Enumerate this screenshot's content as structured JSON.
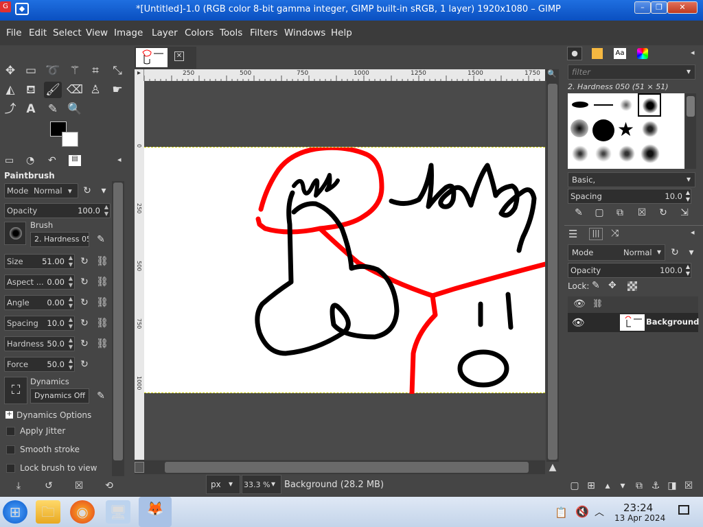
{
  "window": {
    "title": "*[Untitled]-1.0 (RGB color 8-bit gamma integer, GIMP built-in sRGB, 1 layer) 1920x1080 – GIMP",
    "minimize": "–",
    "maximize": "❐",
    "close": "✕"
  },
  "menu": [
    "File",
    "Edit",
    "Select",
    "View",
    "Image",
    "Layer",
    "Colors",
    "Tools",
    "Filters",
    "Windows",
    "Help"
  ],
  "tool_options": {
    "title": "Paintbrush",
    "mode_label": "Mode",
    "mode_value": "Normal",
    "opacity_label": "Opacity",
    "opacity_value": "100.0",
    "brush_label": "Brush",
    "brush_value": "2. Hardness 05",
    "size_label": "Size",
    "size_value": "51.00",
    "aspect_label": "Aspect ...",
    "aspect_value": "0.00",
    "angle_label": "Angle",
    "angle_value": "0.00",
    "spacing_label": "Spacing",
    "spacing_value": "10.0",
    "hardness_label": "Hardness",
    "hardness_value": "50.0",
    "force_label": "Force",
    "force_value": "50.0",
    "dynamics_label": "Dynamics",
    "dynamics_value": "Dynamics Off",
    "dynamics_options": "Dynamics Options",
    "apply_jitter": "Apply Jitter",
    "smooth_stroke": "Smooth stroke",
    "lock_brush": "Lock brush to view"
  },
  "ruler": {
    "top_ticks": [
      "250",
      "500",
      "750",
      "1000",
      "1250",
      "1500",
      "1750"
    ],
    "left_ticks": [
      "0",
      "250",
      "500",
      "750",
      "1000"
    ]
  },
  "status": {
    "unit": "px",
    "zoom": "33.3 %",
    "layer_info": "Background (28.2 MB)"
  },
  "brushes_panel": {
    "filter_placeholder": "filter",
    "brush_name": "2. Hardness 050 (51 × 51)",
    "tag": "Basic,",
    "spacing_label": "Spacing",
    "spacing_value": "10.0"
  },
  "layers_panel": {
    "mode_label": "Mode",
    "mode_value": "Normal",
    "opacity_label": "Opacity",
    "opacity_value": "100.0",
    "lock_label": "Lock:",
    "layer_name": "Background"
  },
  "taskbar": {
    "time": "23:24",
    "date": "13 Apr 2024"
  },
  "colors": {
    "accent_title": "#0a4fc0",
    "stroke_red": "#ff0000",
    "stroke_black": "#000000"
  }
}
